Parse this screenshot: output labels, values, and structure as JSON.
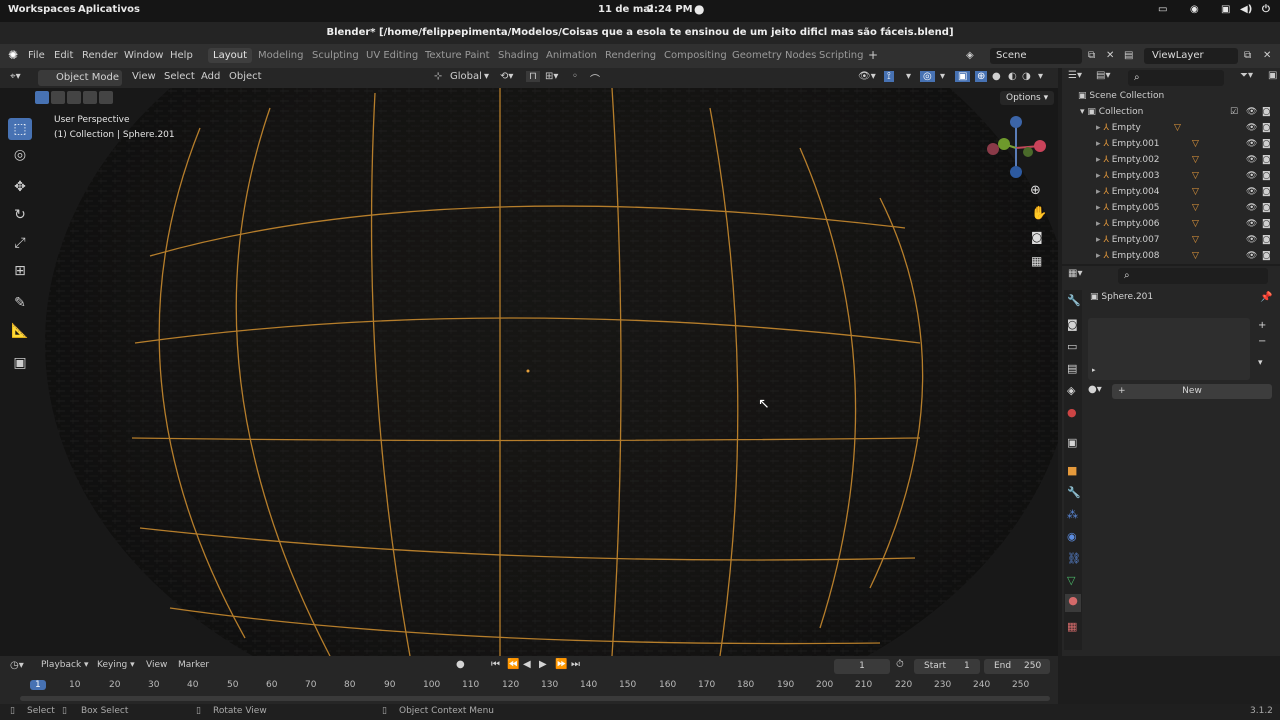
{
  "gnome_bar": {
    "workspaces": "Workspaces",
    "apps": "Aplicativos",
    "date": "11 de mai",
    "time": "2:24 PM"
  },
  "window_title": "Blender* [/home/felippepimenta/Modelos/Coisas que a esola te ensinou de um jeito dificl mas são fáceis.blend]",
  "menu": [
    "File",
    "Edit",
    "Render",
    "Window",
    "Help"
  ],
  "workspace_tabs": [
    "Layout",
    "Modeling",
    "Sculpting",
    "UV Editing",
    "Texture Paint",
    "Shading",
    "Animation",
    "Rendering",
    "Compositing",
    "Geometry Nodes",
    "Scripting"
  ],
  "scene": "Scene",
  "view_layer": "ViewLayer",
  "viewport_header": {
    "mode": "Object Mode",
    "menus": [
      "View",
      "Select",
      "Add",
      "Object"
    ],
    "orientation": "Global"
  },
  "viewport": {
    "perspective": "User Perspective",
    "collection_info": "(1) Collection | Sphere.201",
    "options": "Options"
  },
  "gizmo": {
    "x": "X",
    "y": "Y",
    "z": "Z"
  },
  "outliner": {
    "scene_collection": "Scene Collection",
    "collection": "Collection",
    "items": [
      "Empty",
      "Empty.001",
      "Empty.002",
      "Empty.003",
      "Empty.004",
      "Empty.005",
      "Empty.006",
      "Empty.007",
      "Empty.008"
    ]
  },
  "properties": {
    "object_name": "Sphere.201",
    "new_button": "New"
  },
  "timeline": {
    "menus": [
      "Playback",
      "Keying",
      "View",
      "Marker"
    ],
    "current_frame": "1",
    "start_label": "Start",
    "start": "1",
    "end_label": "End",
    "end": "250",
    "ticks": [
      "1",
      "10",
      "20",
      "30",
      "40",
      "50",
      "60",
      "70",
      "80",
      "90",
      "100",
      "110",
      "120",
      "130",
      "140",
      "150",
      "160",
      "170",
      "180",
      "190",
      "200",
      "210",
      "220",
      "230",
      "240",
      "250"
    ]
  },
  "status_bar": {
    "select": "Select",
    "box_select": "Box Select",
    "rotate": "Rotate View",
    "context": "Object Context Menu",
    "version": "3.1.2"
  },
  "colors": {
    "accent": "#4772b3",
    "wire": "#e6a03c",
    "wire_dim": "#c88a2e"
  }
}
